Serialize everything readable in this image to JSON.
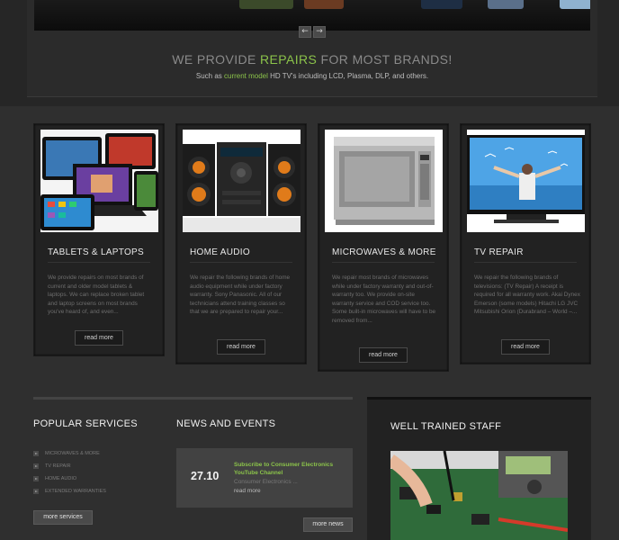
{
  "hero": {
    "prev_arrow": "←",
    "next_arrow": "→",
    "headline_pre": "WE PROVIDE ",
    "headline_highlight": "REPAIRS",
    "headline_post": " FOR MOST BRANDS!",
    "sub_pre": "Such as ",
    "sub_highlight": "current model",
    "sub_post": " HD TV's including LCD, Plasma, DLP, and others."
  },
  "cards": [
    {
      "title": "TABLETS & LAPTOPS",
      "desc": "We provide repairs on most brands of current and older model tablets & laptops. We can replace broken tablet and laptop screens on most brands you've heard of, and even...",
      "button": "read more"
    },
    {
      "title": "HOME AUDIO",
      "desc": "We repair the following brands of home audio equipment while under factory warranty. Sony Panasonic. All of our technicians attend training classes so that we are prepared to repair your...",
      "button": "read more"
    },
    {
      "title": "MICROWAVES & MORE",
      "desc": "We repair most brands of microwaves while under factory warranty and out-of-warranty too. We provide on-site warranty service and COD service too. Some built-in microwaves will have to be removed from...",
      "button": "read more"
    },
    {
      "title": "TV REPAIR",
      "desc": "We repair the following brands of televisions: (TV Repair) A receipt is required for all warranty work. Akai Dynex Emerson (some models) Hitachi LG JVC Mitsubishi Orion (Durabrand – World –...",
      "button": "read more"
    }
  ],
  "popular": {
    "title": "POPULAR SERVICES",
    "items": [
      "MICROWAVES & MORE",
      "TV REPAIR",
      "HOME AUDIO",
      "EXTENDED WARRANTIES"
    ],
    "button": "more services"
  },
  "news": {
    "title": "NEWS AND EVENTS",
    "date": "27.10",
    "headline": "Subscribe to Consumer Electronics YouTube Channel",
    "source": "Consumer Electronics ...",
    "more_link": "read more",
    "button": "more news"
  },
  "staff": {
    "title": "WELL TRAINED STAFF"
  },
  "colors": {
    "accent": "#8bc34a",
    "background": "#2f2f2f",
    "card": "#222222"
  }
}
